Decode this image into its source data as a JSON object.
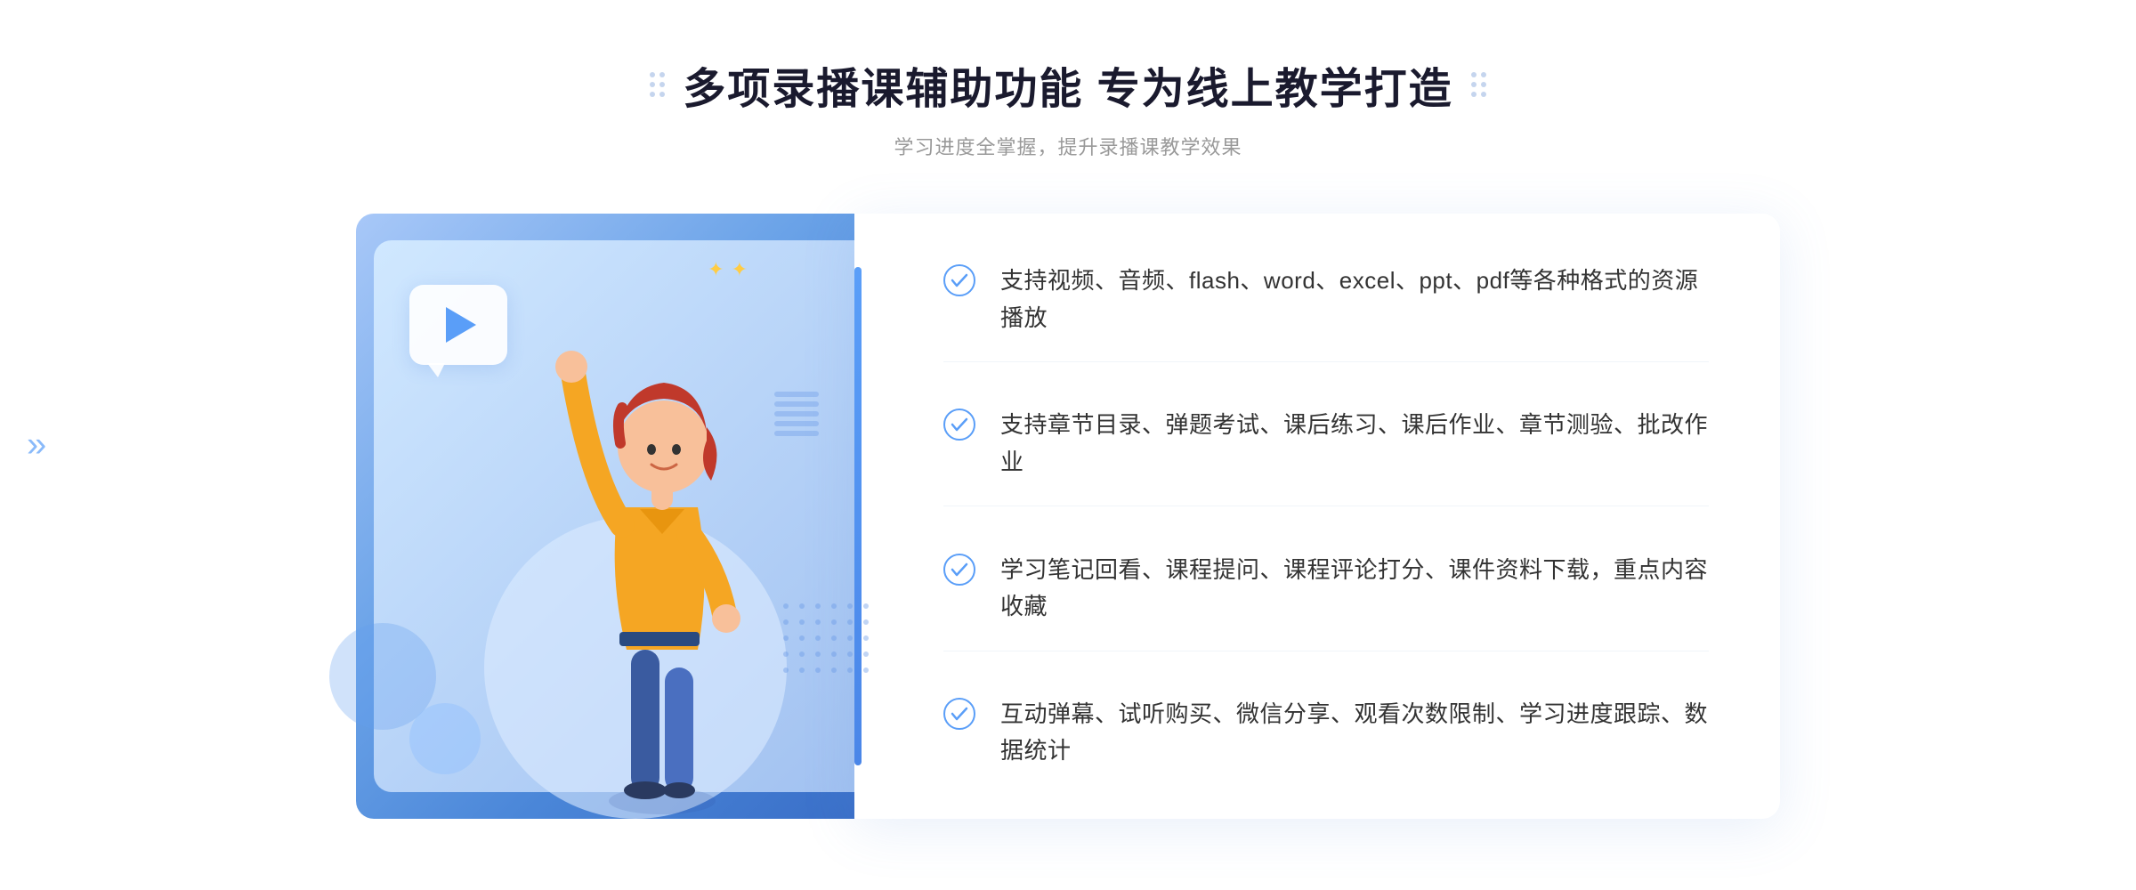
{
  "header": {
    "title": "多项录播课辅助功能 专为线上教学打造",
    "subtitle": "学习进度全掌握，提升录播课教学效果"
  },
  "features": [
    {
      "id": "feature-1",
      "text": "支持视频、音频、flash、word、excel、ppt、pdf等各种格式的资源播放"
    },
    {
      "id": "feature-2",
      "text": "支持章节目录、弹题考试、课后练习、课后作业、章节测验、批改作业"
    },
    {
      "id": "feature-3",
      "text": "学习笔记回看、课程提问、课程评论打分、课件资料下载，重点内容收藏"
    },
    {
      "id": "feature-4",
      "text": "互动弹幕、试听购买、微信分享、观看次数限制、学习进度跟踪、数据统计"
    }
  ],
  "illustration": {
    "play_button_label": "play",
    "dots_label": "decoration dots"
  }
}
